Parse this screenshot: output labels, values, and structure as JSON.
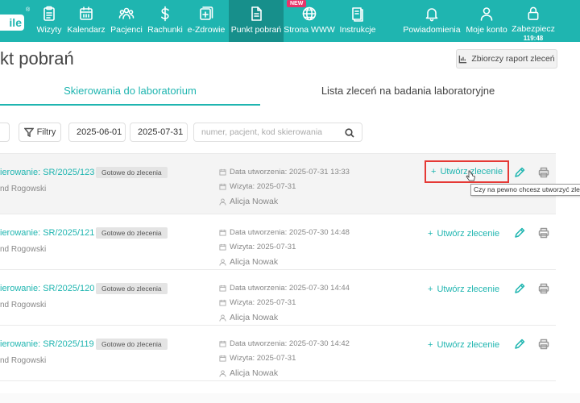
{
  "nav": {
    "logo": "ile",
    "logo_mark": "®",
    "items": [
      {
        "label": "Wizyty",
        "icon": "clipboard-icon"
      },
      {
        "label": "Kalendarz",
        "icon": "calendar-icon"
      },
      {
        "label": "Pacjenci",
        "icon": "patients-icon"
      },
      {
        "label": "Rachunki",
        "icon": "dollar-icon"
      },
      {
        "label": "e-Zdrowie",
        "icon": "medical-plus-icon"
      },
      {
        "label": "Punkt pobrań",
        "icon": "lab-document-icon",
        "active": true
      },
      {
        "label": "Strona WWW",
        "icon": "globe-icon",
        "badge": "NEW"
      },
      {
        "label": "Instrukcje",
        "icon": "book-icon"
      },
      {
        "label": "Powiadomienia",
        "icon": "bell-icon"
      },
      {
        "label": "Moje konto",
        "icon": "user-icon"
      },
      {
        "label": "Zabezpiecz",
        "icon": "lock-icon",
        "sub": "119:48"
      }
    ]
  },
  "page": {
    "title": "kt pobrań",
    "report_button": "Zbiorczy raport zleceń",
    "tabs": [
      "Skierowania do laboratorium",
      "Lista zleceń na badania laboratoryjne"
    ]
  },
  "filters": {
    "filters_label": "Filtry",
    "date_from": "2025-06-01",
    "date_to": "2025-07-31",
    "search_placeholder": "numer, pacjent, kod skierowania"
  },
  "referrals": [
    {
      "title": "ierowanie: SR/2025/123",
      "status": "Gotowe do zlecenia",
      "doctor": "nd Rogowski",
      "created": "Data utworzenia: 2025-07-31 13:33",
      "visit": "Wizyta: 2025-07-31",
      "patient": "Alicja Nowak",
      "action": "Utwórz zlecenie"
    },
    {
      "title": "ierowanie: SR/2025/121",
      "status": "Gotowe do zlecenia",
      "doctor": "nd Rogowski",
      "created": "Data utworzenia: 2025-07-30 14:48",
      "visit": "Wizyta: 2025-07-31",
      "patient": "Alicja Nowak",
      "action": "Utwórz zlecenie"
    },
    {
      "title": "ierowanie: SR/2025/120",
      "status": "Gotowe do zlecenia",
      "doctor": "nd Rogowski",
      "created": "Data utworzenia: 2025-07-30 14:44",
      "visit": "Wizyta: 2025-07-31",
      "patient": "Alicja Nowak",
      "action": "Utwórz zlecenie"
    },
    {
      "title": "ierowanie: SR/2025/119",
      "status": "Gotowe do zlecenia",
      "doctor": "nd Rogowski",
      "created": "Data utworzenia: 2025-07-30 14:42",
      "visit": "Wizyta: 2025-07-31",
      "patient": "Alicja Nowak",
      "action": "Utwórz zlecenie"
    }
  ],
  "tooltip": "Czy na pewno chcesz utworzyć zlecenie",
  "colors": {
    "accent": "#1fb5b0",
    "nav_active": "#178f8b",
    "highlight": "#e53935",
    "badge": "#e8336a"
  }
}
